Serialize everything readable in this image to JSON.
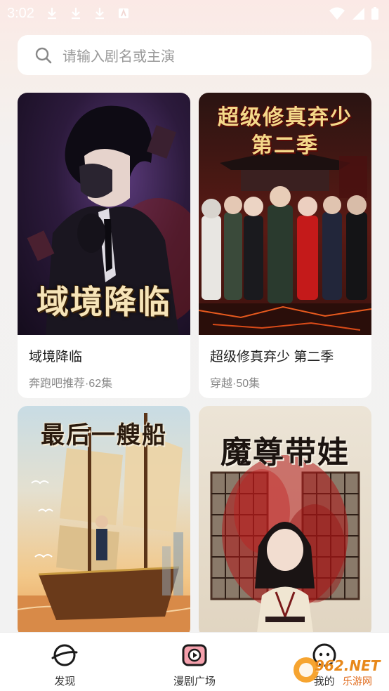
{
  "status_bar": {
    "time": "3:02",
    "notification_icons": [
      "download-icon",
      "download-icon",
      "download-icon",
      "app-icon"
    ],
    "right_icons": [
      "wifi-icon",
      "signal-icon",
      "battery-icon"
    ]
  },
  "search": {
    "placeholder": "请输入剧名或主演",
    "icon": "search-icon"
  },
  "dramas": [
    {
      "title": "域境降临",
      "meta": "奔跑吧推荐·62集",
      "cover_text": "域境降临"
    },
    {
      "title": "超级修真弃少 第二季",
      "meta": "穿越·50集",
      "cover_text_line1": "超级修真弃少",
      "cover_text_line2": "第二季"
    },
    {
      "cover_text": "最后一艘船"
    },
    {
      "cover_text": "魔尊带娃"
    }
  ],
  "bottom_nav": [
    {
      "label": "发现",
      "icon": "discover-icon"
    },
    {
      "label": "漫剧广场",
      "icon": "play-square-icon"
    },
    {
      "label": "我的",
      "icon": "profile-icon"
    }
  ],
  "watermark": {
    "text": "962.NET",
    "subtext": "乐游网"
  },
  "colors": {
    "accent": "#e8475b",
    "background_top": "#fbe9e6",
    "background": "#f2f2f2"
  }
}
